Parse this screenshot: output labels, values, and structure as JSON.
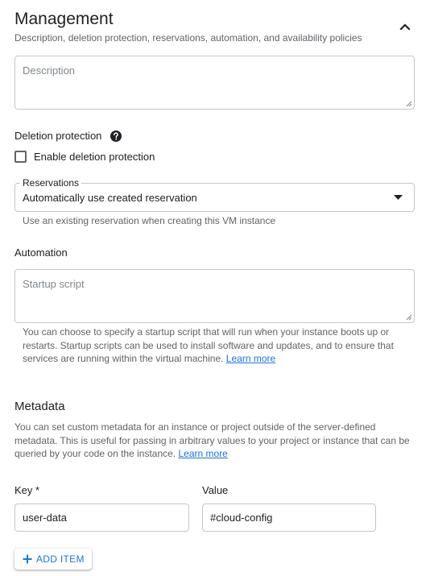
{
  "management": {
    "title": "Management",
    "subtitle": "Description, deletion protection, reservations, automation, and availability policies",
    "collapse_icon": "chevron-up-icon",
    "description_placeholder": "Description"
  },
  "deletion_protection": {
    "heading": "Deletion protection",
    "help_icon": "help-icon",
    "checkbox_label": "Enable deletion protection",
    "checked": false
  },
  "reservations": {
    "label": "Reservations",
    "selected": "Automatically use created reservation",
    "dropdown_icon": "dropdown-arrow-icon",
    "hint": "Use an existing reservation when creating this VM instance"
  },
  "automation": {
    "heading": "Automation",
    "startup_placeholder": "Startup script",
    "help_text": "You can choose to specify a startup script that will run when your instance boots up or restarts. Startup scripts can be used to install software and updates, and to ensure that services are running within the virtual machine.",
    "learn_more": "Learn more"
  },
  "metadata": {
    "heading": "Metadata",
    "help_text": "You can set custom metadata for an instance or project outside of the server-defined metadata. This is useful for passing in arbitrary values to your project or instance that can be queried by your code on the instance.",
    "learn_more": "Learn more",
    "key_label": "Key *",
    "value_label": "Value",
    "key_value": "user-data",
    "value_value": "#cloud-config",
    "add_item_label": "ADD ITEM",
    "add_icon": "plus-icon"
  },
  "colors": {
    "accent": "#1a73e8",
    "text": "#202124",
    "secondary_text": "#5f6368",
    "border": "#c4c7c5"
  }
}
